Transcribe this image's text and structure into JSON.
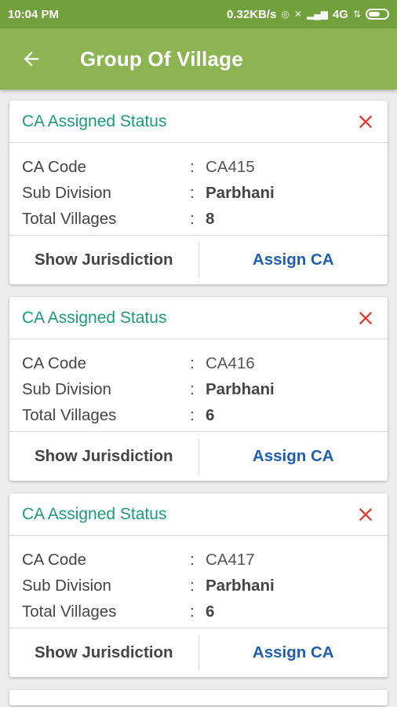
{
  "status_bar": {
    "time": "10:04 PM",
    "speed": "0.32KB/s",
    "network": "4G"
  },
  "app_bar": {
    "title": "Group Of Village",
    "back_icon": "arrow-back-icon"
  },
  "labels": {
    "card_title": "CA Assigned Status",
    "ca_code": "CA Code",
    "sub_division": "Sub Division",
    "total_villages": "Total Villages",
    "colon": ":",
    "show_jurisdiction": "Show Jurisdiction",
    "assign_ca": "Assign CA"
  },
  "cards": [
    {
      "ca_code": "CA415",
      "sub_division": "Parbhani",
      "total_villages": "8"
    },
    {
      "ca_code": "CA416",
      "sub_division": "Parbhani",
      "total_villages": "6"
    },
    {
      "ca_code": "CA417",
      "sub_division": "Parbhani",
      "total_villages": "6"
    }
  ],
  "colors": {
    "status_bar": "#72a03c",
    "app_bar": "#8db453",
    "card_title": "#1b9a7e",
    "close_icon": "#e53935",
    "assign_button": "#1c5fb3"
  }
}
